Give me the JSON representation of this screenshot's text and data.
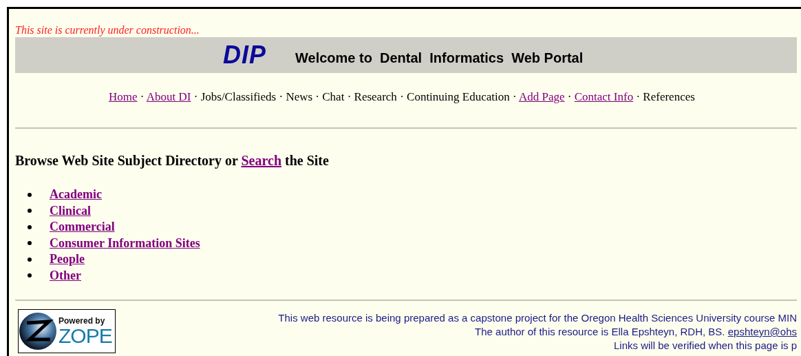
{
  "notice": "This site is currently under construction...",
  "header": {
    "logo": "DIP",
    "title": "Welcome to  Dental  Informatics  Web Portal"
  },
  "nav": [
    {
      "label": "Home",
      "link": true
    },
    {
      "label": "About DI",
      "link": true
    },
    {
      "label": "Jobs/Classifieds",
      "link": false
    },
    {
      "label": "News",
      "link": false
    },
    {
      "label": "Chat",
      "link": false
    },
    {
      "label": "Research",
      "link": false
    },
    {
      "label": "Continuing Education",
      "link": false
    },
    {
      "label": "Add Page",
      "link": true
    },
    {
      "label": "Contact Info",
      "link": true
    },
    {
      "label": "References",
      "link": false
    }
  ],
  "nav_separator": "·",
  "heading": {
    "before": "Browse Web Site Subject Directory or",
    "link": "Search",
    "after": "the Site"
  },
  "directory": [
    "Academic",
    "Clinical",
    "Commercial",
    "Consumer Information Sites",
    "People",
    "Other"
  ],
  "footer": {
    "badge": {
      "line1": "Powered by",
      "line2": "ZOPE"
    },
    "line1": "This web resource is being prepared as a capstone project for the Oregon Health Sciences University course MIN",
    "line2": "The author of this resource is Ella Epshteyn, RDH, BS.",
    "email": "epshteyn@ohs",
    "line3": "Links will be verified when this page is p"
  }
}
